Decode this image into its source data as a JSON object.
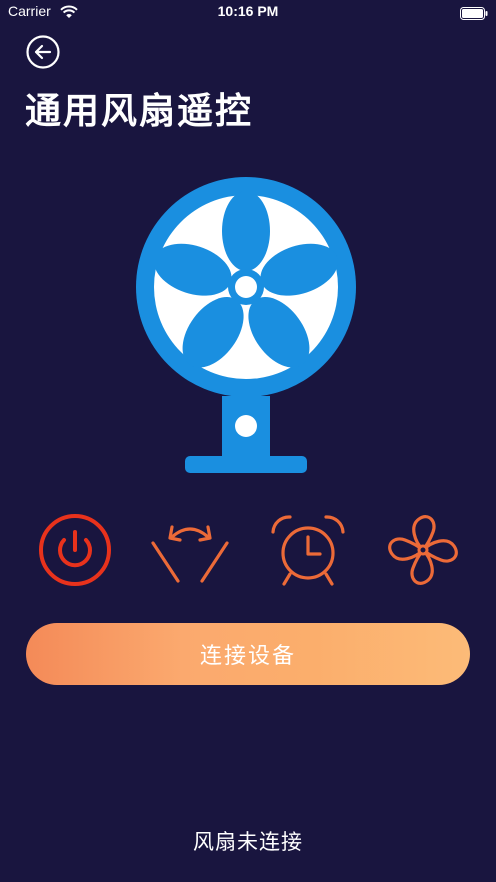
{
  "status_bar": {
    "carrier": "Carrier",
    "time": "10:16 PM",
    "icons": [
      "wifi-icon",
      "battery-icon"
    ]
  },
  "header": {
    "back_icon": "arrow-left-circle-icon",
    "title": "通用风扇遥控"
  },
  "fan": {
    "icon": "electric-fan-icon",
    "color": "#1a8fe0"
  },
  "controls": [
    {
      "name": "power",
      "icon": "power-icon",
      "color": "#e8321c"
    },
    {
      "name": "swing",
      "icon": "oscillate-icon",
      "color": "#ec6a38"
    },
    {
      "name": "timer",
      "icon": "alarm-clock-icon",
      "color": "#ec6a38"
    },
    {
      "name": "speed",
      "icon": "fan-speed-icon",
      "color": "#ec6a38"
    }
  ],
  "connect_button": {
    "label": "连接设备",
    "gradient": [
      "#f48a58",
      "#fcbb78"
    ]
  },
  "connection_status": "风扇未连接",
  "colors": {
    "background": "#19153f",
    "accent_orange": "#ec6a38",
    "power_red": "#e8321c"
  }
}
